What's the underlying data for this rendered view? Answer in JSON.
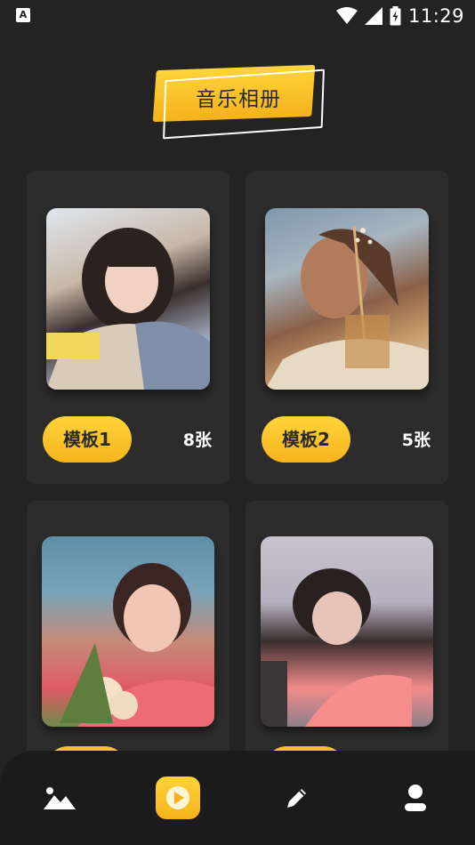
{
  "status_bar": {
    "time": "11:29",
    "app_icon": "A",
    "icons": [
      "wifi-icon",
      "signal-icon",
      "battery-charging-icon"
    ]
  },
  "header": {
    "title": "音乐相册"
  },
  "templates": [
    {
      "label": "模板1",
      "count": "8张",
      "photo": "girl-painting-photo"
    },
    {
      "label": "模板2",
      "count": "5张",
      "photo": "woman-gold-flowers-photo"
    },
    {
      "label": "",
      "count": "",
      "photo": "girl-with-bouquet-photo"
    },
    {
      "label": "",
      "count": "",
      "photo": "girl-pink-top-photo"
    }
  ],
  "bottom_nav": [
    {
      "icon": "image-gallery-icon",
      "active": false
    },
    {
      "icon": "play-icon",
      "active": true
    },
    {
      "icon": "pencil-icon",
      "active": false
    },
    {
      "icon": "user-icon",
      "active": false
    }
  ],
  "colors": {
    "accent": "#ffc928",
    "background": "#232323",
    "card": "#2c2c2c",
    "nav": "#1b1b1b"
  }
}
